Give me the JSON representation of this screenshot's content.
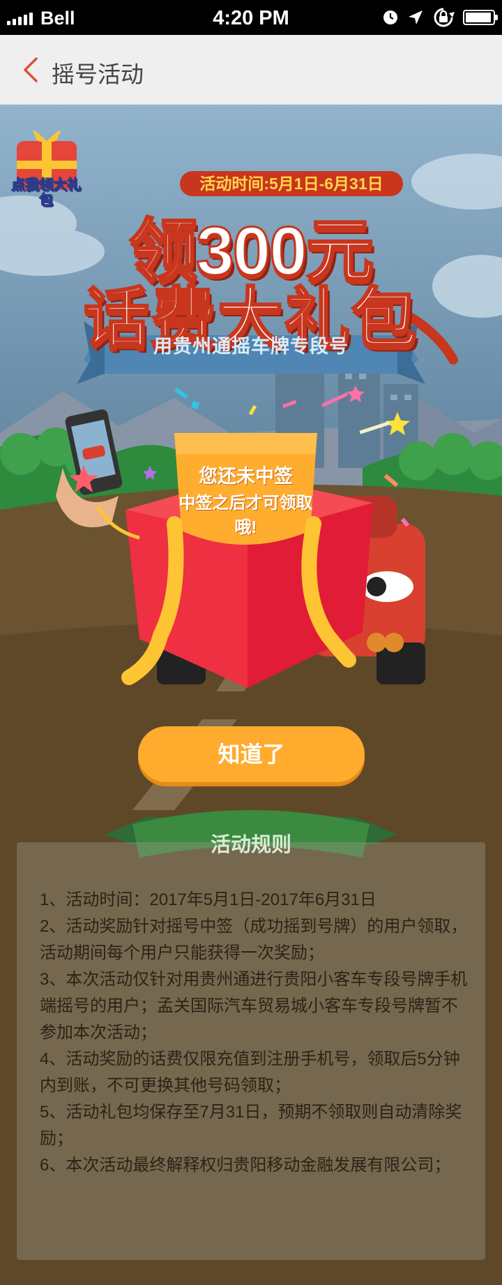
{
  "status_bar": {
    "carrier": "Bell",
    "time": "4:20 PM",
    "battery_level": 0.95,
    "icons": [
      "signal-icon",
      "alarm-icon",
      "location-arrow-icon",
      "rotation-lock-icon",
      "battery-icon"
    ]
  },
  "nav": {
    "back_icon": "chevron-left-icon",
    "title": "摇号活动",
    "accent_color": "#d9523d"
  },
  "promo": {
    "badge_text": "点我领大礼包",
    "date_range": "活动时间:5月1日-6月31日",
    "headline_line1": "领300元",
    "headline_line2": "话费大礼包",
    "subline": "用贵州通摇车牌专段号",
    "note_line1": "您还未中签",
    "note_line2": "中签之后才可领取哦!"
  },
  "ok_button": {
    "label": "知道了",
    "color": "#ffab2e"
  },
  "rules": {
    "title": "活动规则",
    "items": [
      "1、活动时间：2017年5月1日-2017年6月31日",
      "2、活动奖励针对摇号中签（成功摇到号牌）的用户领取，活动期间每个用户只能获得一次奖励；",
      "3、本次活动仅针对用贵州通进行贵阳小客车专段号牌手机端摇号的用户；孟关国际汽车贸易城小客车专段号牌暂不参加本次活动；",
      "4、活动奖励的话费仅限充值到注册手机号，领取后5分钟内到账，不可更换其他号码领取；",
      "5、活动礼包均保存至7月31日，预期不领取则自动清除奖励；",
      "6、本次活动最终解释权归贵阳移动金融发展有限公司；"
    ]
  }
}
